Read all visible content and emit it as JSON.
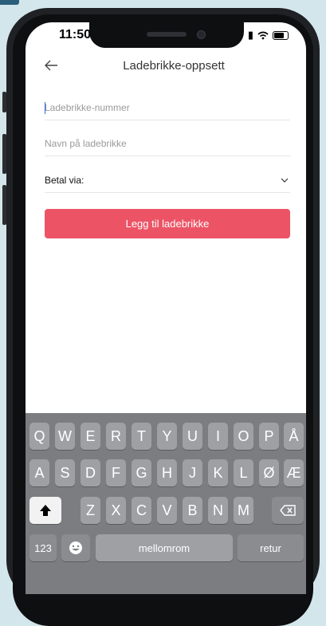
{
  "status_bar": {
    "time": "11:50"
  },
  "header": {
    "title": "Ladebrikke-oppsett"
  },
  "form": {
    "tag_number_placeholder": "Ladebrikke-nummer",
    "tag_name_placeholder": "Navn på ladebrikke",
    "payment_label": "Betal via:",
    "submit_label": "Legg til ladebrikke"
  },
  "keyboard": {
    "row1": [
      "Q",
      "W",
      "E",
      "R",
      "T",
      "Y",
      "U",
      "I",
      "O",
      "P",
      "Å"
    ],
    "row2": [
      "A",
      "S",
      "D",
      "F",
      "G",
      "H",
      "J",
      "K",
      "L",
      "Ø",
      "Æ"
    ],
    "row3": [
      "Z",
      "X",
      "C",
      "V",
      "B",
      "N",
      "M"
    ],
    "numbers_label": "123",
    "space_label": "mellomrom",
    "return_label": "retur"
  },
  "colors": {
    "accent": "#ec5466",
    "background": "#d3e6ec",
    "keyboard": "#7b7d81"
  }
}
